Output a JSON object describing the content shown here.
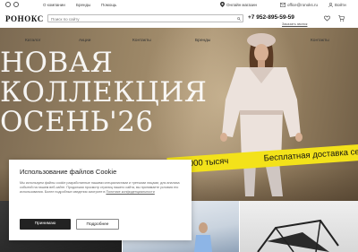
{
  "topbar": {
    "links": [
      "О компании",
      "Бренды",
      "Помощь"
    ],
    "location": "Онлайн магазин",
    "email": "office@ronoks.ru",
    "login": "Войти"
  },
  "header": {
    "logo": "РОНОКС",
    "search_placeholder": "Поиск по сайту",
    "phone": "+7 952-895-59-59",
    "callback": "Заказать звонок"
  },
  "nav": {
    "items": [
      "Каталог",
      "Акции",
      "Контакты",
      "Бренды",
      "Контакты"
    ]
  },
  "hero": {
    "title_lines": [
      "НОВАЯ",
      "КОЛЛЕКЦИЯ",
      "ОСЕНЬ'26"
    ]
  },
  "banner": {
    "left_text": "от 3.000 тысяч",
    "right_text": "Бесплатная доставка сер"
  },
  "cookie": {
    "title": "Использование файлов Cookie",
    "text": "Мы используем файлы cookie разработанные нашими специалистами и третьими лицами, для анализа событий на нашем веб-сайте. Продолжая просмотр страниц нашего сайта, вы принимаете условия его использования. Более подробные сведения смотрите в",
    "link": "Политике конфиденциальности",
    "accept": "Принимаю",
    "more": "Подробнее"
  },
  "colors": {
    "banner": "#f3e21a",
    "accept_button": "#222222",
    "hero_bg": "#9a8565"
  }
}
